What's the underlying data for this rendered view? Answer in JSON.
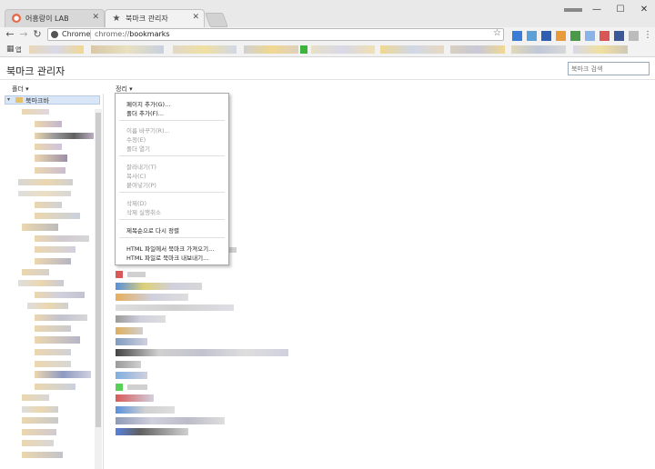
{
  "tabs": [
    {
      "title": "어흥랑이 LAB",
      "icon_color": "#e8694a",
      "active": false
    },
    {
      "title": "북마크 관리자",
      "icon_name": "star-icon",
      "active": true
    }
  ],
  "window_controls": {
    "minimize": "—",
    "maximize": "☐",
    "close": "✕"
  },
  "toolbar": {
    "back": "←",
    "forward": "→",
    "reload": "↻",
    "omnibox_chip": "Chrome",
    "url_prefix": "chrome://",
    "url_path": "bookmarks",
    "star": "☆"
  },
  "bookmarks_bar": {
    "apps_icon": "⋮⋮⋮",
    "apps_label": "앱"
  },
  "manager": {
    "title": "북마크 관리자",
    "search_placeholder": "북마크 검색",
    "folders_menu": "폴더 ▾",
    "organize_menu": "정리 ▾",
    "tree_root": "북마크바"
  },
  "context_menu": {
    "groups": [
      [
        {
          "label": "페이지 추가(G)...",
          "enabled": true
        },
        {
          "label": "폴더 추가(F)...",
          "enabled": true
        }
      ],
      [
        {
          "label": "이름 바꾸기(R)...",
          "enabled": false
        },
        {
          "label": "수정(E)",
          "enabled": false
        },
        {
          "label": "폴더 열기",
          "enabled": false
        }
      ],
      [
        {
          "label": "잘라내기(T)",
          "enabled": false
        },
        {
          "label": "복사(C)",
          "enabled": false
        },
        {
          "label": "붙여넣기(P)",
          "enabled": false
        }
      ],
      [
        {
          "label": "삭제(D)",
          "enabled": false
        },
        {
          "label": "삭제 실행취소",
          "enabled": false
        }
      ],
      [
        {
          "label": "제목순으로 다시 정렬",
          "enabled": true
        }
      ],
      [
        {
          "label": "HTML 파일에서 북마크 가져오기...",
          "enabled": true
        },
        {
          "label": "HTML 파일로 북마크 내보내기...",
          "enabled": true
        }
      ]
    ]
  }
}
